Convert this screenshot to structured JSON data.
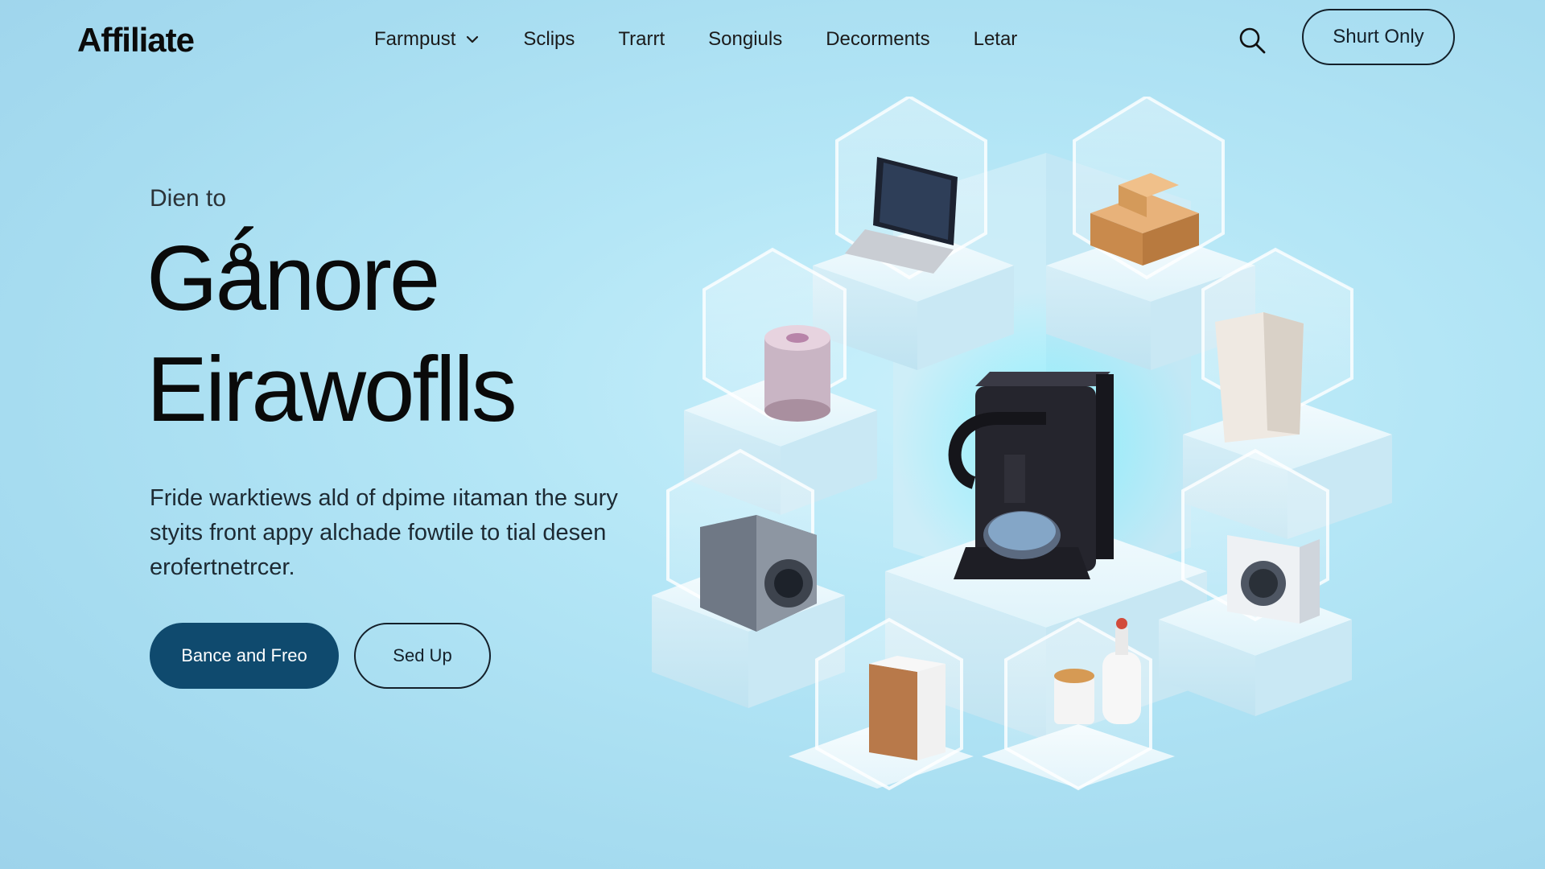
{
  "nav": {
    "logo": "Affiliate",
    "links": [
      "Farmpust",
      "Sclips",
      "Trarrt",
      "Songiuls",
      "Decorments",
      "Letar"
    ],
    "cta": "Shurt Only"
  },
  "hero": {
    "eyebrow": "Dien to",
    "title_line1": "Gǻnore",
    "title_line2": "Eirawoflls",
    "description": "Fride warktiews ald of dpime ıitaman the sury styits front appy alchade fowtile to tial desen erofertnetrcer.",
    "primary_button": "Bance and Freo",
    "secondary_button": "Sed Up"
  },
  "icons": {
    "search": "search-icon",
    "chevron": "chevron-down-icon"
  },
  "colors": {
    "accent": "#0f4a6e",
    "background": "#b4e6f6",
    "text": "#0a0a0a"
  },
  "illustration_items": [
    "laptop",
    "wooden-blocks",
    "tin-canister",
    "paper-bag",
    "coffee-maker",
    "camera",
    "washing-machine",
    "wood-speaker",
    "cup-and-bottle"
  ]
}
